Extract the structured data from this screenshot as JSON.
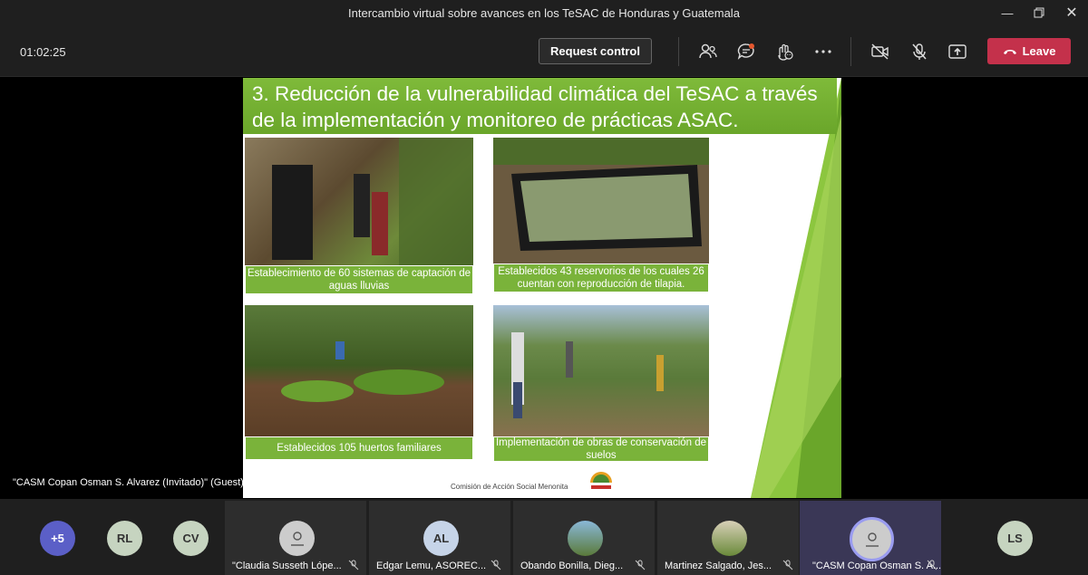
{
  "window": {
    "title": "Intercambio virtual sobre avances en los TeSAC de Honduras y Guatemala"
  },
  "toolbar": {
    "timer": "01:02:25",
    "request_control": "Request control",
    "leave": "Leave"
  },
  "slide": {
    "title": "3. Reducción de la vulnerabilidad climática del TeSAC a través de la implementación y monitoreo de prácticas ASAC.",
    "captions": [
      "Establecimiento de 60 sistemas de captación de aguas lluvias",
      "Establecidos 43 reservorios de los cuales 26 cuentan con reproducción de tilapia.",
      "Establecidos 105 huertos familiares",
      "Implementación de obras de conservación de suelos"
    ],
    "footer": "Comisión de Acción Social Menonita"
  },
  "speaker_label": "\"CASM Copan Osman S. Alvarez (Invitado)\" (Guest)",
  "participants": {
    "more": "+5",
    "avatars": [
      "RL",
      "CV"
    ],
    "tiles": [
      {
        "name": "\"Claudia Susseth Lópe..."
      },
      {
        "initials": "AL",
        "name": "Edgar Lemu, ASOREC..."
      },
      {
        "name": "Obando Bonilla, Dieg..."
      },
      {
        "name": "Martinez Salgado, Jes..."
      },
      {
        "name": "\"CASM Copan Osman S. A..."
      }
    ],
    "last": "LS"
  },
  "colors": {
    "accent_red": "#c4314b",
    "slide_green": "#7ab33a",
    "tile_active": "#3a3756"
  }
}
